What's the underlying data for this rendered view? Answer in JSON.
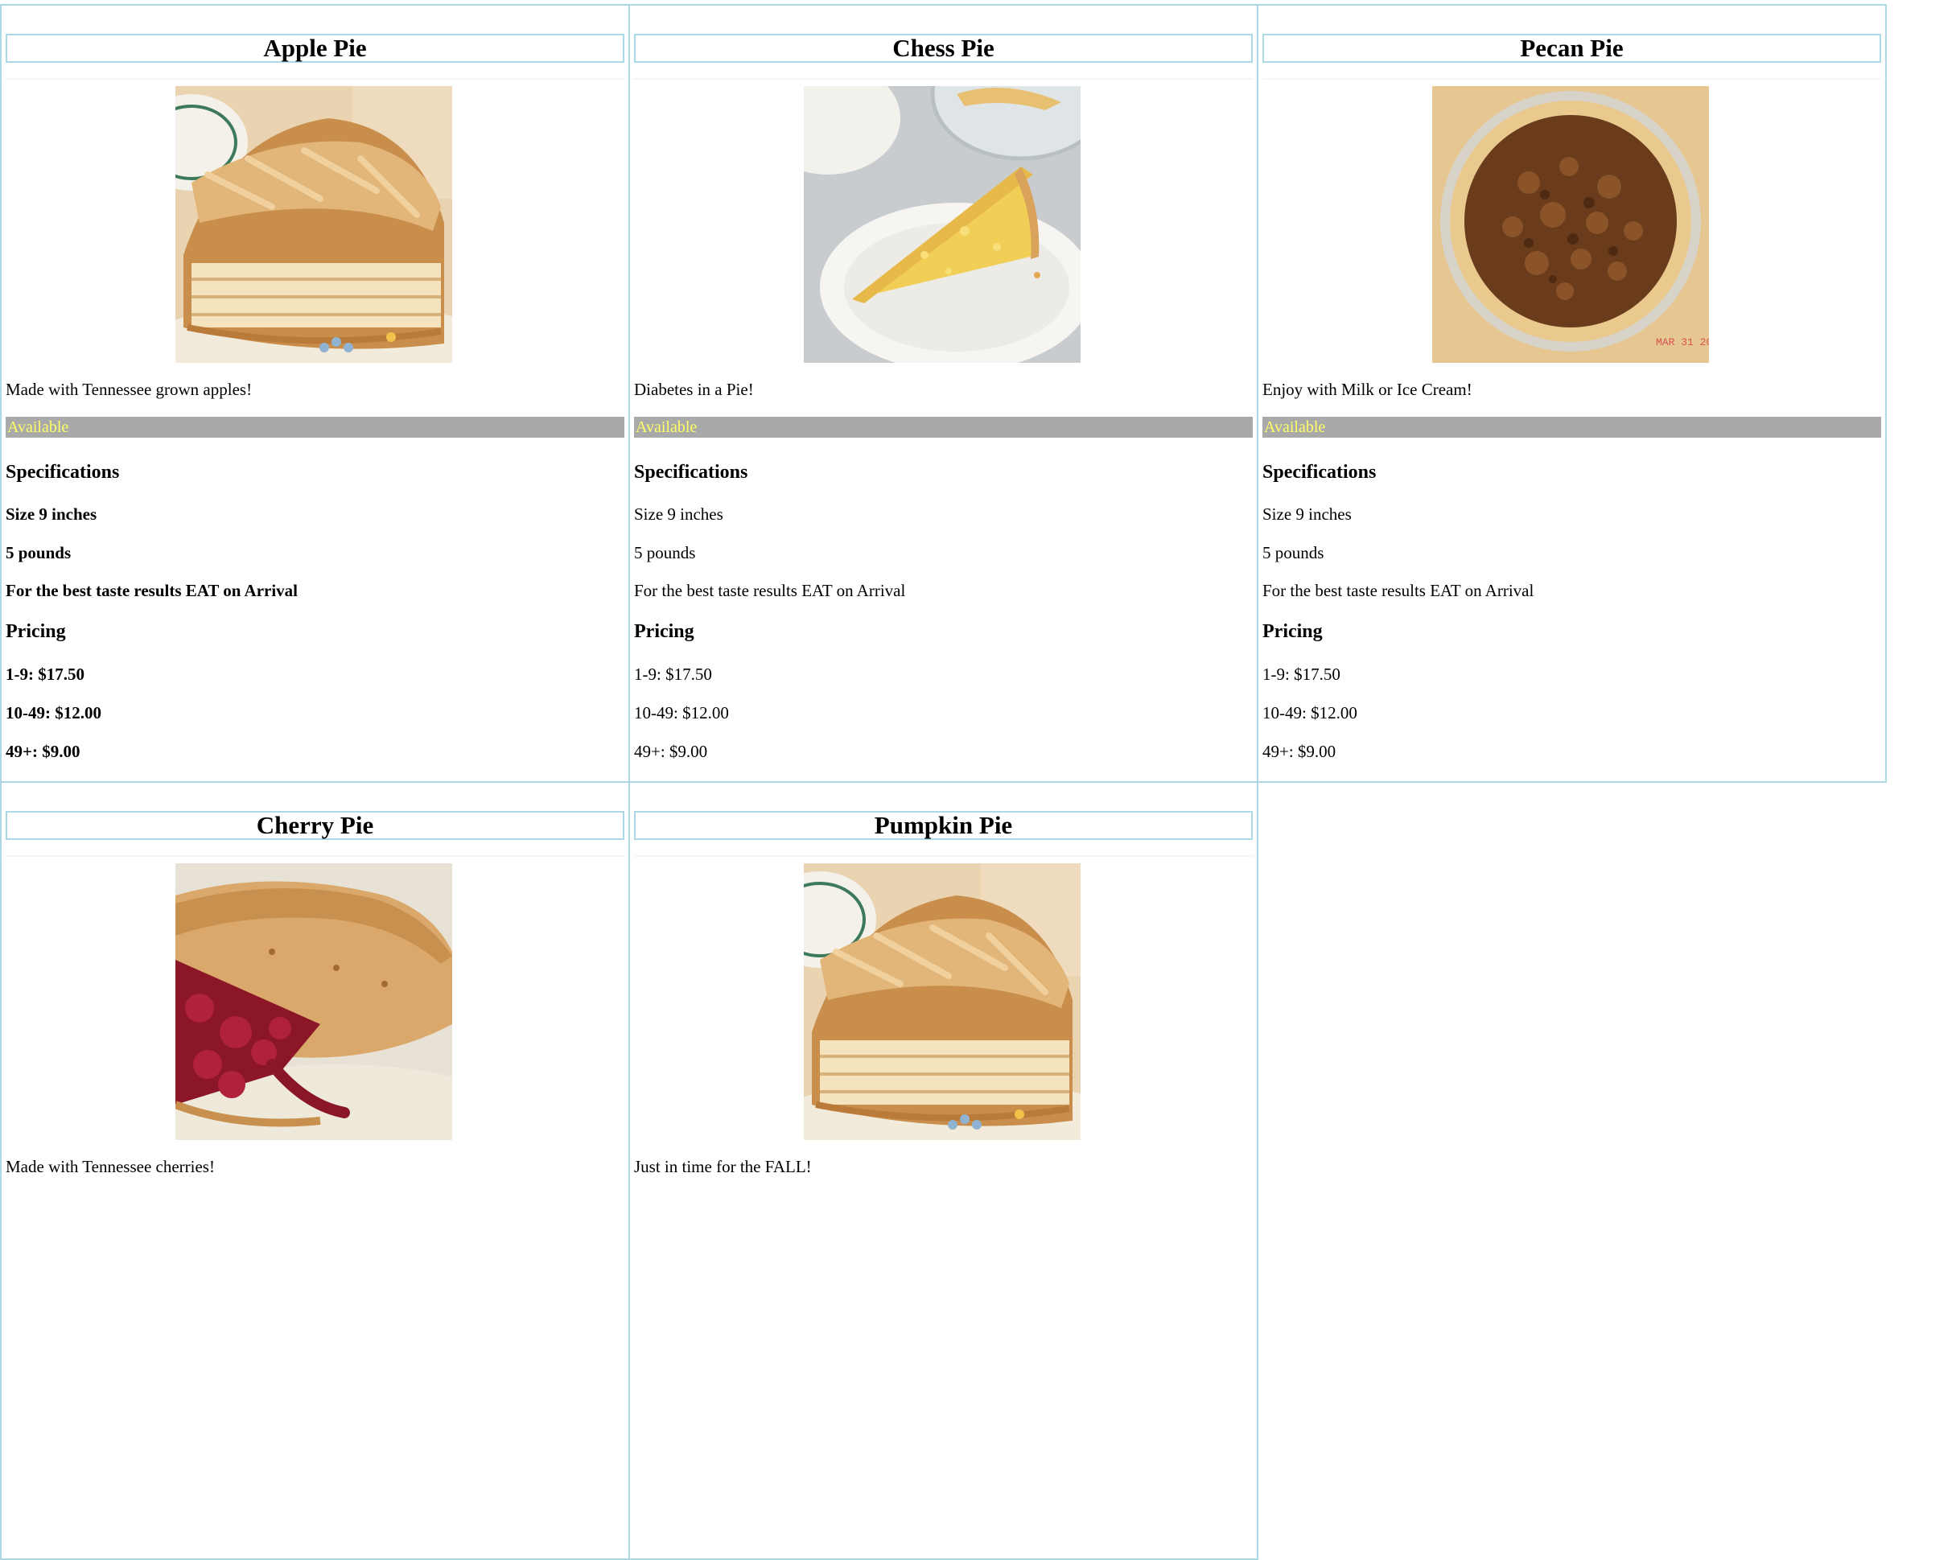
{
  "pies": [
    {
      "name": "Apple Pie",
      "description": "Made with Tennessee grown apples!",
      "status": "Available",
      "specifications_heading": "Specifications",
      "size": "Size 9 inches",
      "weight": "5 pounds",
      "note": "For the best taste results EAT on Arrival",
      "pricing_heading": "Pricing",
      "price_tier_1": "1-9: $17.50",
      "price_tier_2": "10-49: $12.00",
      "price_tier_3": "49+: $9.00",
      "image_icon": "apple-pie-photo"
    },
    {
      "name": "Chess Pie",
      "description": "Diabetes in a Pie!",
      "status": "Available",
      "specifications_heading": "Specifications",
      "size": "Size 9 inches",
      "weight": "5 pounds",
      "note": "For the best taste results EAT on Arrival",
      "pricing_heading": "Pricing",
      "price_tier_1": "1-9: $17.50",
      "price_tier_2": "10-49: $12.00",
      "price_tier_3": "49+: $9.00",
      "image_icon": "chess-pie-photo"
    },
    {
      "name": "Pecan Pie",
      "description": "Enjoy with Milk or Ice Cream!",
      "status": "Available",
      "specifications_heading": "Specifications",
      "size": "Size 9 inches",
      "weight": "5 pounds",
      "note": "For the best taste results EAT on Arrival",
      "pricing_heading": "Pricing",
      "price_tier_1": "1-9: $17.50",
      "price_tier_2": "10-49: $12.00",
      "price_tier_3": "49+: $9.00",
      "image_icon": "pecan-pie-photo",
      "photo_date_stamp": "MAR 31 20"
    },
    {
      "name": "Cherry Pie",
      "description": "Made with Tennessee cherries!",
      "image_icon": "cherry-pie-photo"
    },
    {
      "name": "Pumpkin Pie",
      "description": "Just in time for the FALL!",
      "image_icon": "apple-pie-photo"
    }
  ],
  "colors": {
    "card_border": "#add8e6",
    "status_background": "#a9a9a9",
    "status_text": "#ffff66"
  }
}
